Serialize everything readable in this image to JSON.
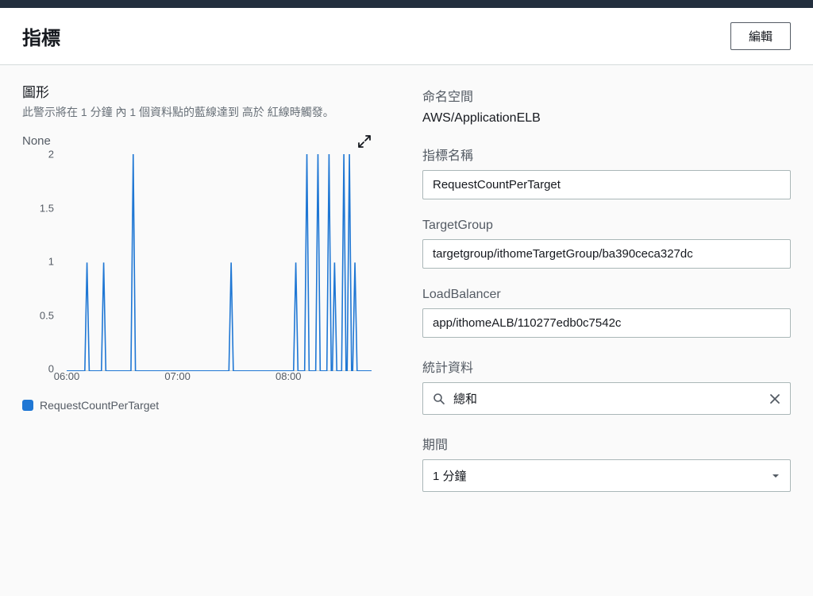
{
  "header": {
    "title": "指標",
    "edit_label": "編輯"
  },
  "left": {
    "section_label": "圖形",
    "section_desc": "此警示將在 1 分鐘 內 1 個資料點的藍線達到 高於 紅線時觸發。",
    "chart_title": "None",
    "legend_label": "RequestCountPerTarget"
  },
  "chart_data": {
    "type": "line",
    "title": "None",
    "xlabel": "",
    "ylabel": "",
    "ylim": [
      0,
      2
    ],
    "y_ticks": [
      0,
      0.5,
      1,
      1.5,
      2
    ],
    "x_range_minutes": [
      360,
      525
    ],
    "x_ticks": [
      {
        "min": 360,
        "label": "06:00"
      },
      {
        "min": 420,
        "label": "07:00"
      },
      {
        "min": 480,
        "label": "08:00"
      }
    ],
    "series": [
      {
        "name": "RequestCountPerTarget",
        "color": "#1f77d4",
        "spikes": [
          {
            "x": 371,
            "y": 1
          },
          {
            "x": 380,
            "y": 1
          },
          {
            "x": 396,
            "y": 2
          },
          {
            "x": 449,
            "y": 1
          },
          {
            "x": 484,
            "y": 1
          },
          {
            "x": 490,
            "y": 2
          },
          {
            "x": 496,
            "y": 2
          },
          {
            "x": 502,
            "y": 2
          },
          {
            "x": 505,
            "y": 1
          },
          {
            "x": 510,
            "y": 2
          },
          {
            "x": 513,
            "y": 2
          },
          {
            "x": 516,
            "y": 1
          }
        ]
      }
    ]
  },
  "right": {
    "namespace_label": "命名空間",
    "namespace_value": "AWS/ApplicationELB",
    "metric_name_label": "指標名稱",
    "metric_name_value": "RequestCountPerTarget",
    "target_group_label": "TargetGroup",
    "target_group_value": "targetgroup/ithomeTargetGroup/ba390ceca327dc",
    "load_balancer_label": "LoadBalancer",
    "load_balancer_value": "app/ithomeALB/110277edb0c7542c",
    "statistic_label": "統計資料",
    "statistic_value": "總和",
    "period_label": "期間",
    "period_value": "1 分鐘"
  }
}
